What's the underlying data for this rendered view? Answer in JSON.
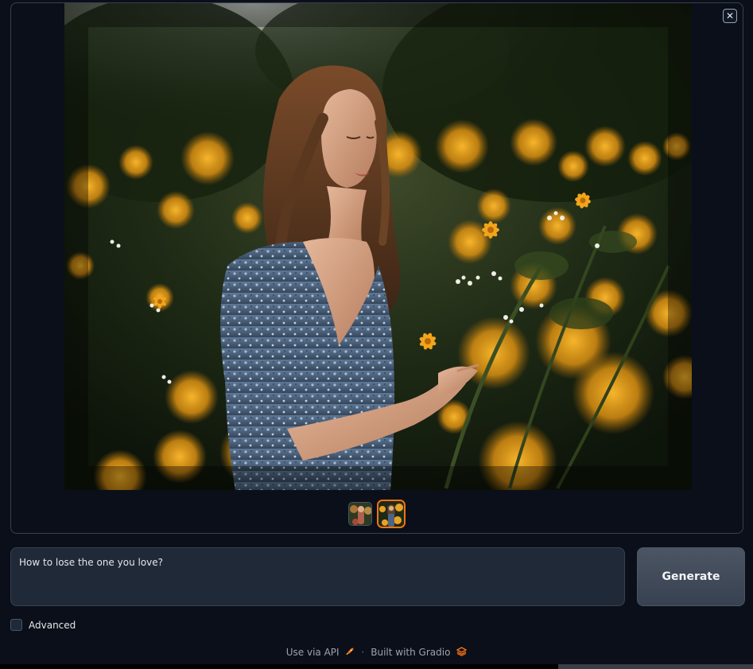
{
  "gallery": {
    "close_label": "✕",
    "thumbnails": [
      {
        "name": "thumbnail-1",
        "selected": false
      },
      {
        "name": "thumbnail-2",
        "selected": true
      }
    ]
  },
  "prompt": {
    "value": "How to lose the one you love?"
  },
  "actions": {
    "generate_label": "Generate"
  },
  "advanced": {
    "label": "Advanced",
    "checked": false
  },
  "footer": {
    "api_label": "Use via API",
    "separator": "·",
    "built_label": "Built with Gradio"
  },
  "colors": {
    "background": "#0b0f19",
    "panel_border": "#374151",
    "accent": "#f97316",
    "input_bg": "#1f2937"
  },
  "icons": {
    "api": "rocket-icon",
    "gradio": "gradio-logo-icon",
    "close": "close-icon"
  }
}
